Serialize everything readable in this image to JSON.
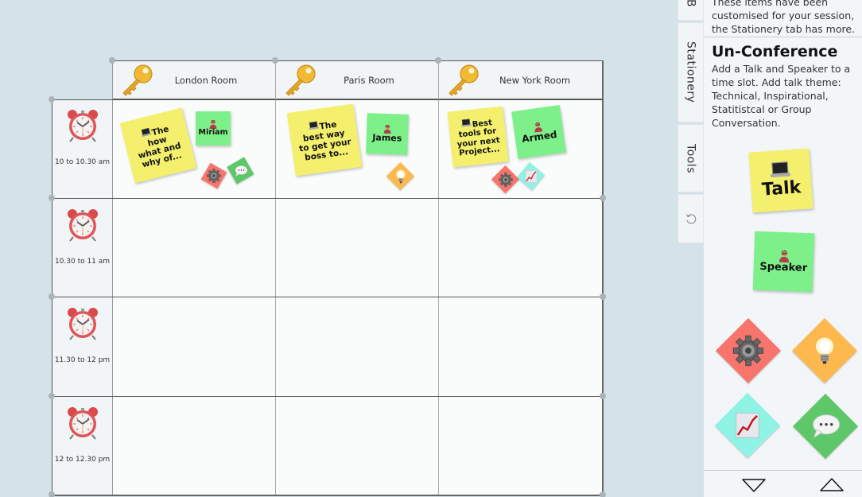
{
  "board": {
    "rooms": [
      {
        "name": "London Room",
        "icon": "key-icon"
      },
      {
        "name": "Paris Room",
        "icon": "key-icon"
      },
      {
        "name": "New York Room",
        "icon": "key-icon"
      }
    ],
    "time_slots": [
      {
        "label": "10 to 10.30 am",
        "icon": "alarm-clock-icon"
      },
      {
        "label": "10.30 to 11 am",
        "icon": "alarm-clock-icon"
      },
      {
        "label": "11.30 to 12 pm",
        "icon": "alarm-clock-icon"
      },
      {
        "label": "12 to 12.30 pm",
        "icon": "alarm-clock-icon"
      }
    ],
    "sessions": [
      {
        "room": "London Room",
        "slot": "10 to 10.30 am",
        "talk": {
          "emoji": "💻",
          "lines": [
            "The",
            "how",
            "what and",
            "why of..."
          ]
        },
        "speaker": {
          "emoji": "🦸",
          "name": "Miriam"
        },
        "themes": [
          "Technical",
          "Group Conversation"
        ]
      },
      {
        "room": "Paris Room",
        "slot": "10 to 10.30 am",
        "talk": {
          "emoji": "💻",
          "lines": [
            "The",
            "best way",
            "to get your",
            "boss to..."
          ]
        },
        "speaker": {
          "emoji": "🧑",
          "name": "James"
        },
        "themes": [
          "Inspirational"
        ]
      },
      {
        "room": "New York Room",
        "slot": "10 to 10.30 am",
        "talk": {
          "emoji": "💻",
          "lines": [
            "Best",
            "tools for",
            "your next",
            "Project..."
          ]
        },
        "speaker": {
          "emoji": "🧑‍💻",
          "name": "Armed"
        },
        "themes": [
          "Technical",
          "Statistical"
        ]
      }
    ]
  },
  "side_tabs": {
    "top_partial": "B",
    "stationery": "Stationery",
    "tools": "Tools",
    "undo_icon": "undo-icon"
  },
  "panel": {
    "intro": "These items have been customised for your session, the Stationery tab has more.",
    "title": "Un-Conference",
    "description": "Add a Talk and Speaker to a time slot. Add talk theme: Technical, Inspirational, Statitistcal or Group Conversation.",
    "items": {
      "talk": {
        "emoji": "💻",
        "label": "Talk"
      },
      "speaker": {
        "emoji": "🦸",
        "label": "Speaker"
      }
    },
    "themes": [
      {
        "name": "Technical",
        "icon": "gear-icon",
        "color": "#f7756c"
      },
      {
        "name": "Inspirational",
        "icon": "lightbulb-icon",
        "color": "#fdb94e"
      },
      {
        "name": "Statistical",
        "icon": "chart-increasing-icon",
        "color": "#8ef3e4"
      },
      {
        "name": "Group Conversation",
        "icon": "speech-bubble-icon",
        "color": "#5ec76a"
      }
    ],
    "scroll_down": "scroll-down",
    "scroll_up": "scroll-up"
  },
  "colors": {
    "background": "#d4e3ea",
    "talk_sticky": "#f4f06e",
    "speaker_sticky": "#7ef089",
    "technical": "#f7756c",
    "inspirational": "#fdb94e",
    "statistical": "#8ef3e4",
    "group_conversation": "#5ec76a"
  }
}
